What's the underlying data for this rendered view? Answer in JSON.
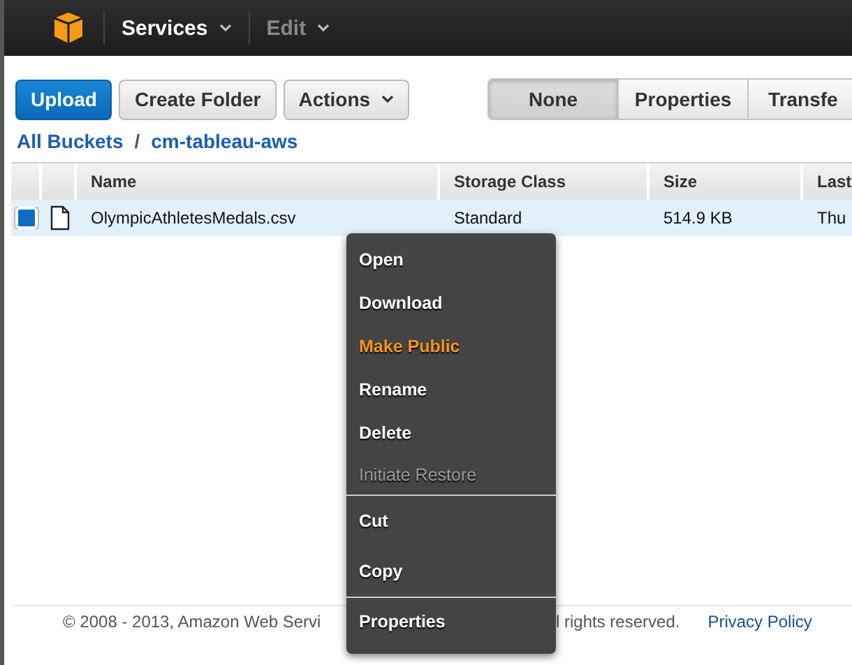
{
  "header": {
    "menus": [
      {
        "label": "Services",
        "disabled": false
      },
      {
        "label": "Edit",
        "disabled": true
      }
    ]
  },
  "toolbar": {
    "buttons": [
      {
        "label": "Upload",
        "kind": "primary"
      },
      {
        "label": "Create Folder",
        "kind": "plain"
      },
      {
        "label": "Actions",
        "kind": "dropdown"
      }
    ],
    "tabs": [
      {
        "label": "None",
        "selected": true
      },
      {
        "label": "Properties",
        "selected": false
      },
      {
        "label": "Transfe",
        "selected": false
      }
    ]
  },
  "breadcrumb": {
    "separator": "/",
    "items": [
      "All Buckets",
      "cm-tableau-aws"
    ]
  },
  "table": {
    "columns": [
      "Name",
      "Storage Class",
      "Size",
      "Last"
    ],
    "rows": [
      {
        "checked": true,
        "selected": true,
        "cells": [
          "OlympicAthletesMedals.csv",
          "Standard",
          "514.9 KB",
          "Thu"
        ]
      }
    ]
  },
  "context_menu": {
    "sections": [
      [
        {
          "label": "Open",
          "highlighted": false,
          "disabled": false
        },
        {
          "label": "Download",
          "highlighted": false,
          "disabled": false
        },
        {
          "label": "Make Public",
          "highlighted": true,
          "disabled": false
        },
        {
          "label": "Rename",
          "highlighted": false,
          "disabled": false
        },
        {
          "label": "Delete",
          "highlighted": false,
          "disabled": false
        },
        {
          "label": "Initiate Restore",
          "highlighted": false,
          "disabled": true
        }
      ],
      [
        {
          "label": "Cut",
          "highlighted": false,
          "disabled": false
        },
        {
          "label": "Copy",
          "highlighted": false,
          "disabled": false
        }
      ],
      [
        {
          "label": "Properties",
          "highlighted": false,
          "disabled": false
        }
      ]
    ]
  },
  "footer": {
    "copyright_start": "© 2008 - 2013, Amazon Web Servi",
    "copyright_end": "l rights reserved.",
    "link": "Privacy Policy"
  }
}
